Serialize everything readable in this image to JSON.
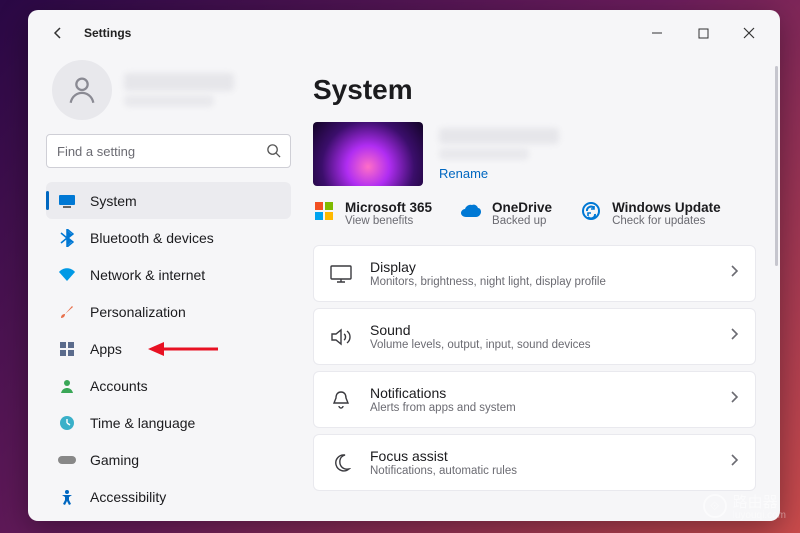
{
  "titlebar": {
    "title": "Settings"
  },
  "search": {
    "placeholder": "Find a setting"
  },
  "sidebar": {
    "items": [
      {
        "label": "System"
      },
      {
        "label": "Bluetooth & devices"
      },
      {
        "label": "Network & internet"
      },
      {
        "label": "Personalization"
      },
      {
        "label": "Apps"
      },
      {
        "label": "Accounts"
      },
      {
        "label": "Time & language"
      },
      {
        "label": "Gaming"
      },
      {
        "label": "Accessibility"
      }
    ]
  },
  "page": {
    "title": "System",
    "rename": "Rename"
  },
  "status": [
    {
      "title": "Microsoft 365",
      "sub": "View benefits"
    },
    {
      "title": "OneDrive",
      "sub": "Backed up"
    },
    {
      "title": "Windows Update",
      "sub": "Check for updates"
    }
  ],
  "cards": [
    {
      "title": "Display",
      "sub": "Monitors, brightness, night light, display profile"
    },
    {
      "title": "Sound",
      "sub": "Volume levels, output, input, sound devices"
    },
    {
      "title": "Notifications",
      "sub": "Alerts from apps and system"
    },
    {
      "title": "Focus assist",
      "sub": "Notifications, automatic rules"
    }
  ],
  "watermark": {
    "text": "路由器",
    "sub": "luyouqi.com"
  }
}
